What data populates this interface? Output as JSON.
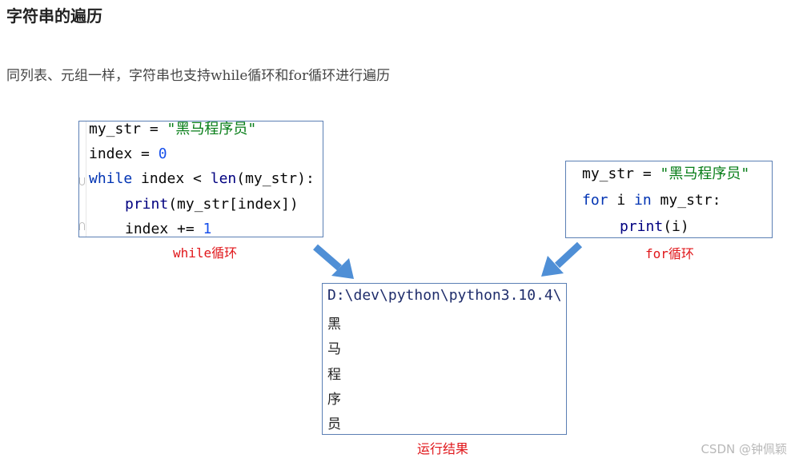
{
  "heading": "字符串的遍历",
  "paragraph": "同列表、元组一样，字符串也支持while循环和for循环进行遍历",
  "while_code": {
    "l1_var": "my_str",
    "l1_eq": " = ",
    "l1_str": "\"黑马程序员\"",
    "l2_a": "index = ",
    "l2_num": "0",
    "l3_kw": "while",
    "l3_a": " index < ",
    "l3_fn": "len",
    "l3_b": "(my_str):",
    "l4_fn": "print",
    "l4_a": "(my_str[index])",
    "l5_a": "index += ",
    "l5_num": "1",
    "caption": "while循环"
  },
  "for_code": {
    "l1_var": "my_str",
    "l1_eq": " = ",
    "l1_str": "\"黑马程序员\"",
    "l2_kw1": "for",
    "l2_a": " i ",
    "l2_kw2": "in",
    "l2_b": " my_str:",
    "l3_fn": "print",
    "l3_a": "(i)",
    "caption": "for循环"
  },
  "output": {
    "path": "D:\\dev\\python\\python3.10.4\\",
    "chars": [
      "黑",
      "马",
      "程",
      "序",
      "员"
    ],
    "caption": "运行结果"
  },
  "watermark": "CSDN @钟佩颖",
  "colors": {
    "border": "#5b7fb4",
    "arrow": "#4f8fd6",
    "caption_red": "#e0161a"
  }
}
